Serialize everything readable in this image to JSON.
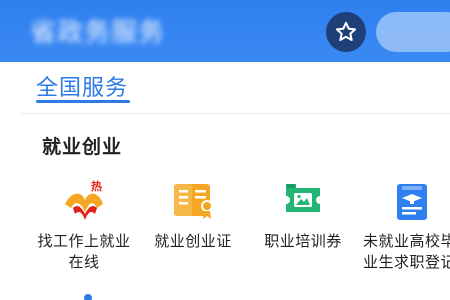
{
  "header": {
    "title": "省政务服务",
    "favorite_icon": "star-icon",
    "accent": "#3a89f3"
  },
  "section": {
    "title": "全国服务",
    "subsection": "就业创业"
  },
  "services": [
    {
      "icon": "job-hunting-hot-icon",
      "line1": "找工作上就业",
      "line2": "在线"
    },
    {
      "icon": "employment-certificate-icon",
      "line1": "就业创业证",
      "line2": ""
    },
    {
      "icon": "training-voucher-icon",
      "line1": "职业培训券",
      "line2": ""
    },
    {
      "icon": "graduate-job-registration-icon",
      "line1": "未就业高校毕",
      "line2": "业生求职登记"
    }
  ]
}
